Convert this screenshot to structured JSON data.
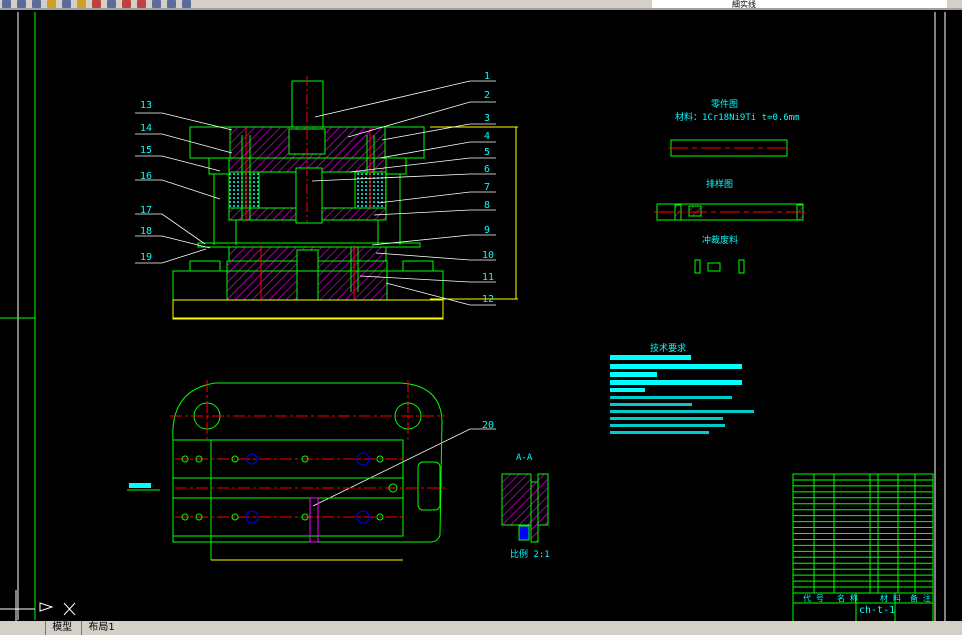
{
  "toolbar": {
    "layer_name": "細实线"
  },
  "tabs": [
    {
      "label": "模型"
    },
    {
      "label": "布局1"
    }
  ],
  "colors": {
    "background": "#000000",
    "outline": "#00ff00",
    "center_line": "#ff0000",
    "hatch": "#ff00ff",
    "text": "#00ffff",
    "dimension": "#ffff00",
    "leader": "#ffffff"
  },
  "assembly": {
    "part_numbers": [
      "1",
      "2",
      "3",
      "4",
      "5",
      "6",
      "7",
      "8",
      "9",
      "10",
      "11",
      "12",
      "13",
      "14",
      "15",
      "16",
      "17",
      "18",
      "19",
      "20"
    ]
  },
  "part_drawing": {
    "title": "零件图",
    "material": "材料：1Cr18Ni9Ti  t=0.6mm"
  },
  "layout_drawing": {
    "title": "排样图"
  },
  "scrap_drawing": {
    "title": "冲裁废料"
  },
  "section": {
    "title": "A-A",
    "scale": "比例 2:1"
  },
  "tech_requirements": {
    "title": "技术要求"
  },
  "title_block": {
    "headers": [
      "代 号",
      "名 称",
      "材 料",
      "备 注"
    ],
    "drawing_code": "ch-t-1"
  }
}
